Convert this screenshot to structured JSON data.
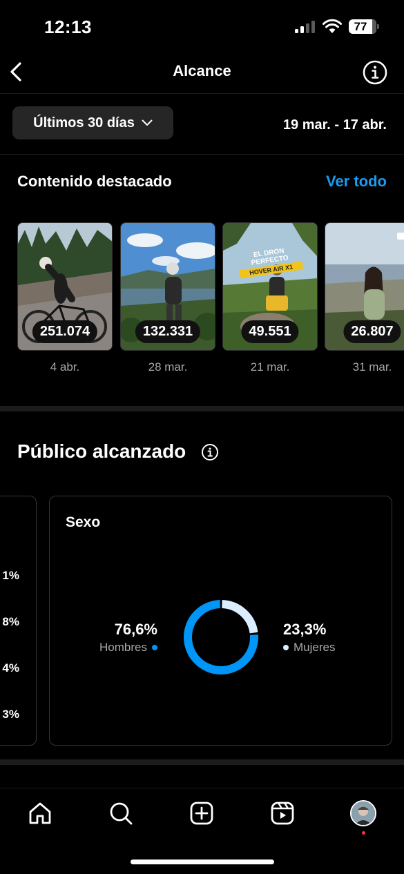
{
  "status_bar": {
    "time": "12:13",
    "battery": "77"
  },
  "header": {
    "title": "Alcance"
  },
  "filter": {
    "period_label": "Últimos 30 días",
    "date_range": "19 mar. - 17 abr."
  },
  "featured": {
    "title": "Contenido destacado",
    "see_all": "Ver todo",
    "items": [
      {
        "count": "251.074",
        "date": "4 abr."
      },
      {
        "count": "132.331",
        "date": "28 mar."
      },
      {
        "count": "49.551",
        "date": "21 mar.",
        "banner_line1": "EL DRON PERFECTO",
        "banner_line2": "HOVER AIR X1"
      },
      {
        "count": "26.807",
        "date": "31 mar."
      }
    ]
  },
  "audience": {
    "title": "Público alcanzado",
    "left_card_values": [
      "1%",
      "8%",
      "4%",
      "3%"
    ],
    "sex_card": {
      "title": "Sexo",
      "men_pct": "76,6%",
      "men_label": "Hombres",
      "women_pct": "23,3%",
      "women_label": "Mujeres",
      "men_fraction": 0.766,
      "women_fraction": 0.233,
      "men_color": "#0095f6",
      "women_color": "#dbeeff"
    }
  },
  "nav": {
    "icons": [
      "home-icon",
      "search-icon",
      "create-icon",
      "reels-icon",
      "profile-avatar"
    ]
  },
  "colors": {
    "accent": "#1a9bf0",
    "background": "#000000",
    "notification": "#ff3040"
  }
}
